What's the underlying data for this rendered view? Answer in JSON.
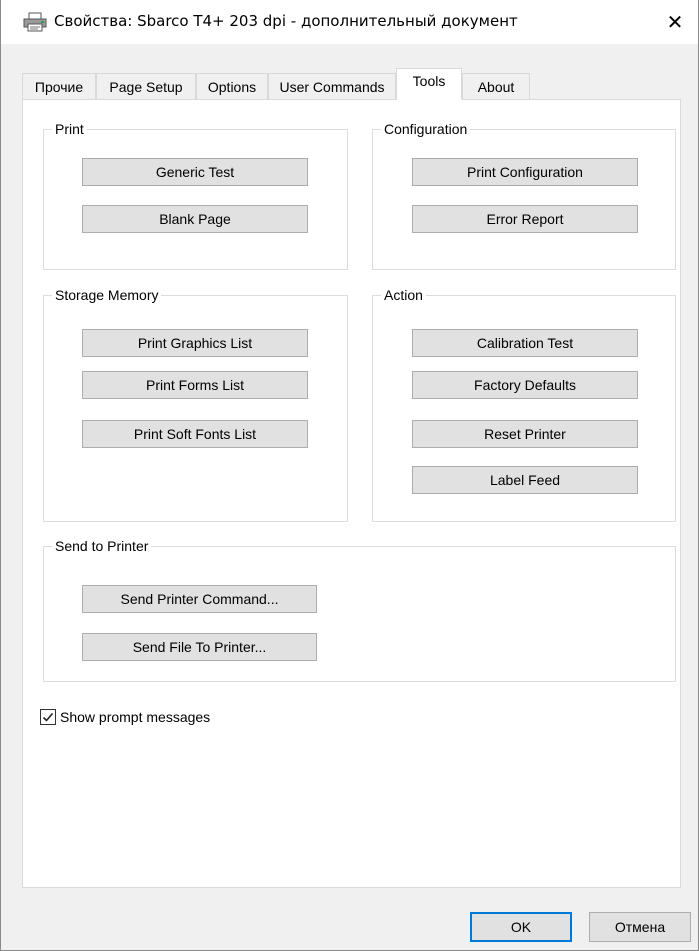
{
  "window": {
    "title": "Свойства: Sbarco T4+ 203 dpi - дополнительный документ",
    "close_glyph": "✕"
  },
  "tabs": [
    {
      "label": "Прочие",
      "active": false
    },
    {
      "label": "Page Setup",
      "active": false
    },
    {
      "label": "Options",
      "active": false
    },
    {
      "label": "User Commands",
      "active": false
    },
    {
      "label": "Tools",
      "active": true
    },
    {
      "label": "About",
      "active": false
    }
  ],
  "groups": {
    "print": {
      "title": "Print",
      "buttons": [
        "Generic Test",
        "Blank Page"
      ]
    },
    "configuration": {
      "title": "Configuration",
      "buttons": [
        "Print Configuration",
        "Error Report"
      ]
    },
    "storage": {
      "title": "Storage Memory",
      "buttons": [
        "Print Graphics List",
        "Print Forms List",
        "Print Soft Fonts List"
      ]
    },
    "action": {
      "title": "Action",
      "buttons": [
        "Calibration Test",
        "Factory Defaults",
        "Reset Printer",
        "Label Feed"
      ]
    },
    "send": {
      "title": "Send to Printer",
      "buttons": [
        "Send Printer Command...",
        "Send File To Printer..."
      ]
    }
  },
  "show_prompt": {
    "label": "Show prompt messages",
    "checked": true
  },
  "footer": {
    "ok_label": "OK",
    "cancel_label": "Отмена"
  },
  "colors": {
    "accent": "#0078d7",
    "button_face": "#e1e1e1",
    "button_border": "#adadad"
  },
  "icons": {
    "title": "printer-icon",
    "close": "close-icon",
    "check": "checkmark-icon"
  }
}
